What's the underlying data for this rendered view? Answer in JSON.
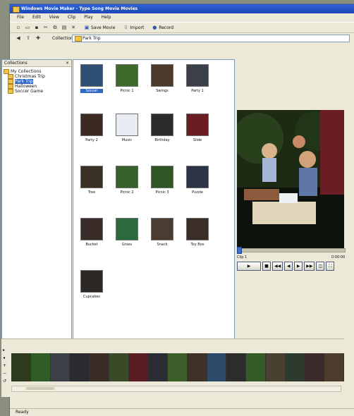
{
  "window": {
    "title": "Windows Movie Maker - Type Song Movie Movies"
  },
  "menu": [
    "File",
    "Edit",
    "View",
    "Clip",
    "Play",
    "Help"
  ],
  "toolbar": {
    "buttons": [
      "Save Movie",
      "Import",
      "Record"
    ]
  },
  "address": {
    "label": "Collections",
    "value": "Park Trip"
  },
  "collections": {
    "header": "Collections",
    "items": [
      {
        "label": "My Collections",
        "level": 0,
        "selected": false
      },
      {
        "label": "Christmas Trip",
        "level": 1,
        "selected": false
      },
      {
        "label": "Park Trip",
        "level": 1,
        "selected": true
      },
      {
        "label": "Halloween",
        "level": 1,
        "selected": false
      },
      {
        "label": "Soccer Game",
        "level": 1,
        "selected": false
      }
    ]
  },
  "clips": [
    {
      "caption": "Soccer",
      "thumb_color": "#2f4f74",
      "selected": true
    },
    {
      "caption": "Picnic 1",
      "thumb_color": "#3e6a2c",
      "selected": false
    },
    {
      "caption": "Swings",
      "thumb_color": "#4b3a2a",
      "selected": false
    },
    {
      "caption": "Party 1",
      "thumb_color": "#3a3f4a",
      "selected": false
    },
    {
      "caption": "Party 2",
      "thumb_color": "#3b2a22",
      "selected": false
    },
    {
      "caption": "Music",
      "thumb_color": "#e8ecf2",
      "selected": false
    },
    {
      "caption": "Birthday",
      "thumb_color": "#2d2a2e",
      "selected": false
    },
    {
      "caption": "Slide",
      "thumb_color": "#6a1e22",
      "selected": false
    },
    {
      "caption": "Tree",
      "thumb_color": "#3a3024",
      "selected": false
    },
    {
      "caption": "Picnic 2",
      "thumb_color": "#37612a",
      "selected": false
    },
    {
      "caption": "Picnic 3",
      "thumb_color": "#2f5524",
      "selected": false
    },
    {
      "caption": "Puzzle",
      "thumb_color": "#2b3346",
      "selected": false
    },
    {
      "caption": "Bucket",
      "thumb_color": "#3a2c28",
      "selected": false
    },
    {
      "caption": "Grass",
      "thumb_color": "#2b6a3c",
      "selected": false
    },
    {
      "caption": "Snack",
      "thumb_color": "#4a3c30",
      "selected": false
    },
    {
      "caption": "Toy Box",
      "thumb_color": "#3a2e26",
      "selected": false
    },
    {
      "caption": "Cupcakes",
      "thumb_color": "#2c2826",
      "selected": false
    }
  ],
  "preview": {
    "label": "Clip 1",
    "time_label": "0:00:00"
  },
  "controls": [
    "▶",
    "■",
    "◀◀",
    "◀",
    "▶",
    "▶▶",
    "◫",
    "⛶"
  ],
  "storyboard": {
    "tools": [
      "▸",
      "◂",
      "+",
      "−",
      "↺"
    ],
    "frames": [
      "#2d3a1e",
      "#2f5c27",
      "#3d3f47",
      "#2b2a30",
      "#3c2c26",
      "#394a28",
      "#5a1c22",
      "#2a2d33",
      "#3c5f2a",
      "#3f3128",
      "#2c4a6a",
      "#2c2c2c",
      "#345a28",
      "#4a4030",
      "#2d3a2e",
      "#3a2a2a",
      "#4b3c2c"
    ]
  },
  "status": {
    "text": "Ready"
  }
}
